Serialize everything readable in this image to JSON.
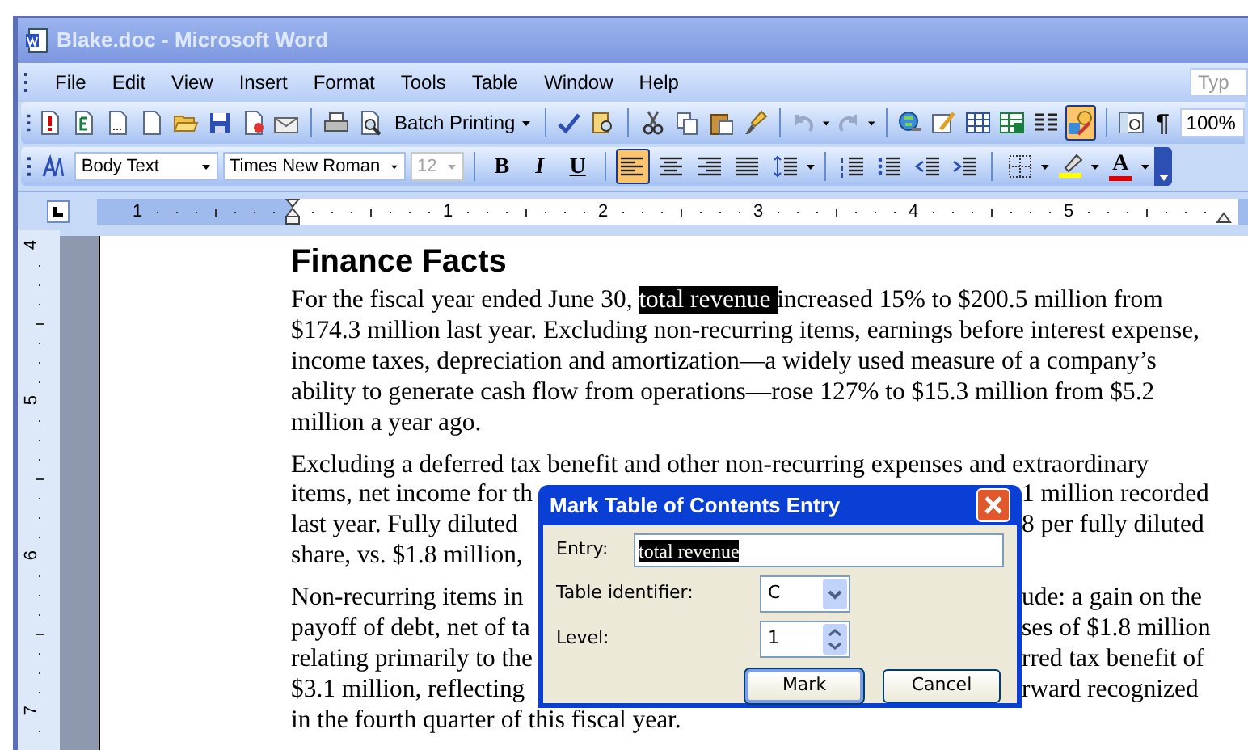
{
  "window": {
    "title": "Blake.doc - Microsoft Word"
  },
  "menu_bar": {
    "items": [
      "File",
      "Edit",
      "View",
      "Insert",
      "Format",
      "Tools",
      "Table",
      "Window",
      "Help"
    ],
    "question_box": {
      "placeholder": "Typ"
    }
  },
  "standard_toolbar": {
    "batch_printing": "Batch Printing",
    "drawing_on": true,
    "show_marks": "¶",
    "zoom": "100%"
  },
  "formatting_toolbar": {
    "style": "Body Text",
    "font": "Times New Roman",
    "size": "12",
    "size_disabled": true,
    "bold": "B",
    "italic": "I",
    "underline": "U",
    "align_left_on": true,
    "font_color": "A"
  },
  "ruler": {
    "labels": [
      "1",
      "1",
      "2",
      "3",
      "4",
      "5"
    ]
  },
  "vertical_ruler": {
    "labels": [
      "4",
      "5",
      "6",
      "7"
    ]
  },
  "document": {
    "heading": "Finance Facts",
    "paragraphs": [
      {
        "lines": [
          {
            "segments": [
              {
                "text": "For the fiscal year ended June 30, ",
                "highlighted": false
              },
              {
                "text": "total revenue ",
                "highlighted": true
              },
              {
                "text": "increased 15% to $200.5 million from",
                "highlighted": false
              }
            ]
          },
          {
            "segments": [
              {
                "text": "$174.3 million last year. Excluding non-recurring items, earnings before interest expense,",
                "highlighted": false
              }
            ]
          },
          {
            "segments": [
              {
                "text": "income taxes, depreciation and amortization—a widely used measure of a company’s",
                "highlighted": false
              }
            ]
          },
          {
            "segments": [
              {
                "text": "ability to generate cash flow from operations—rose 127% to $15.3 million from $5.2",
                "highlighted": false
              }
            ]
          },
          {
            "segments": [
              {
                "text": "million a year ago.",
                "highlighted": false
              }
            ]
          }
        ]
      },
      {
        "lines": [
          {
            "left": "Excluding a deferred tax benefit and other non-recurring expenses and extraordinary"
          },
          {
            "left": "items, net income for th",
            "right": "1 million recorded"
          },
          {
            "left": "last year. Fully diluted",
            "right": "8 per fully diluted"
          },
          {
            "left": "share, vs. $1.8 million,"
          }
        ]
      },
      {
        "lines": [
          {
            "left": "Non-recurring items in",
            "right": "ude: a gain on the"
          },
          {
            "left": "payoff of debt, net of ta",
            "right": "ses of $1.8 million"
          },
          {
            "left": "relating primarily to the",
            "right": "rred tax benefit of"
          },
          {
            "left": "$3.1 million, reflecting",
            "right": "rward recognized"
          },
          {
            "left": "in the fourth quarter of this fiscal year."
          }
        ]
      }
    ]
  },
  "dialog": {
    "title": "Mark Table of Contents Entry",
    "entry_label": "Entry:",
    "entry_value": "total revenue",
    "table_identifier_label": "Table identifier:",
    "table_identifier_value": "C",
    "level_label": "Level:",
    "level_value": "1",
    "buttons": [
      {
        "label": "Mark",
        "default": true
      },
      {
        "label": "Cancel",
        "default": false
      }
    ]
  }
}
